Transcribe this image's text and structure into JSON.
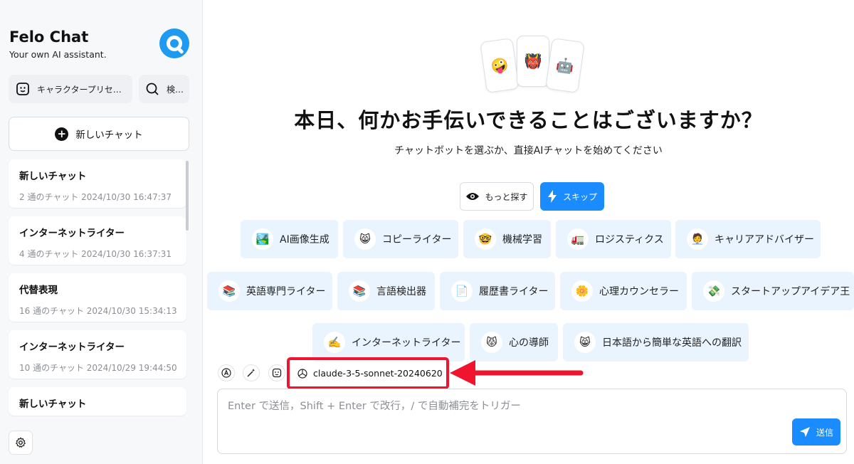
{
  "sidebar": {
    "brand_title": "Felo Chat",
    "brand_subtitle": "Your own AI assistant.",
    "preset_button": "キャラクタープリセ…",
    "search_button": "検…",
    "new_chat": "新しいチャット",
    "chats": [
      {
        "title": "新しいチャット",
        "meta": "2 通のチャット   2024/10/30 16:47:37"
      },
      {
        "title": "インターネットライター",
        "meta": "4 通のチャット   2024/10/30 16:37:31"
      },
      {
        "title": "代替表現",
        "meta": "16 通のチャット  2024/10/30 15:34:13"
      },
      {
        "title": "インターネットライター",
        "meta": "10 通のチャット 2024/10/29 19:44:50"
      },
      {
        "title": "新しいチャット",
        "meta": ""
      }
    ]
  },
  "main": {
    "card_emojis": [
      "🤪",
      "👹",
      "🤖"
    ],
    "headline": "本日、何かお手伝いできることはございますか？",
    "subline": "チャットボットを選ぶか、直接AIチャットを始めてください",
    "explore_button": "もっと探す",
    "skip_button": "スキップ",
    "bots": [
      {
        "emoji": "🏞️",
        "label": "AI画像生成"
      },
      {
        "emoji": "😸",
        "label": "コピーライター"
      },
      {
        "emoji": "🤓",
        "label": "機械学習"
      },
      {
        "emoji": "🚛",
        "label": "ロジスティクス"
      },
      {
        "emoji": "🧑‍💼",
        "label": "キャリアアドバイザー"
      },
      {
        "emoji": "📚",
        "label": "英語専門ライター"
      },
      {
        "emoji": "📚",
        "label": "言語検出器"
      },
      {
        "emoji": "📄",
        "label": "履歴書ライター"
      },
      {
        "emoji": "🌼",
        "label": "心理カウンセラー"
      },
      {
        "emoji": "💸",
        "label": "スタートアップアイデア王"
      },
      {
        "emoji": "✍️",
        "label": "インターネットライター"
      },
      {
        "emoji": "😾",
        "label": "心の導師"
      },
      {
        "emoji": "😸",
        "label": "日本語から簡単な英語への翻訳"
      }
    ],
    "model_name": "claude-3-5-sonnet-20240620",
    "input_placeholder": "Enter で送信，Shift + Enter で改行，/ で自動補完をトリガー",
    "send_button": "送信"
  },
  "colors": {
    "accent": "#1a8cff",
    "highlight": "#f0142f",
    "bot_bg": "#eaf4ff"
  }
}
